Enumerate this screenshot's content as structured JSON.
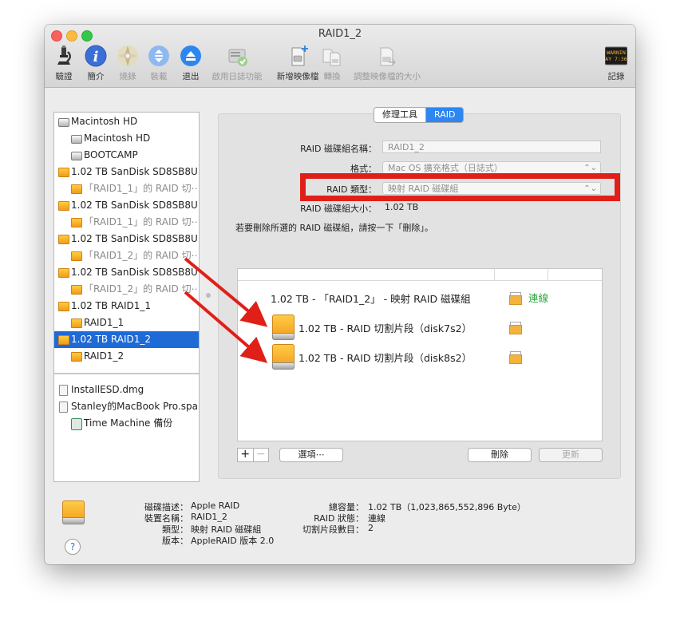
{
  "window": {
    "title": "RAID1_2"
  },
  "toolbar": {
    "items": [
      {
        "label": "驗證",
        "icon": "microscope-icon",
        "enabled": true
      },
      {
        "label": "簡介",
        "icon": "info-icon",
        "enabled": true
      },
      {
        "label": "燒錄",
        "icon": "burn-disc-icon",
        "enabled": false
      },
      {
        "label": "裝載",
        "icon": "mount-icon",
        "enabled": false
      },
      {
        "label": "退出",
        "icon": "eject-icon",
        "enabled": true
      },
      {
        "label": "啟用日誌功能",
        "icon": "journal-disk-icon",
        "enabled": false
      },
      {
        "label": "新增映像檔",
        "icon": "new-image-icon",
        "enabled": true
      },
      {
        "label": "轉換",
        "icon": "convert-icon",
        "enabled": false
      },
      {
        "label": "調整映像檔的大小",
        "icon": "resize-image-icon",
        "enabled": false
      }
    ],
    "log": {
      "label": "記錄",
      "icon": "log-icon",
      "screen_line1": "WARNIN",
      "screen_line2": "AY 7:36"
    }
  },
  "sidebar": {
    "items": [
      {
        "label": "Macintosh HD",
        "icon": "hard-disk-icon"
      },
      {
        "label": "Macintosh HD",
        "icon": "hard-disk-icon"
      },
      {
        "label": "BOOTCAMP",
        "icon": "hard-disk-icon"
      },
      {
        "label": "1.02 TB SanDisk SD8SB8U...",
        "icon": "orange-disk-icon"
      },
      {
        "label": "「RAID1_1」的 RAID 切⋯",
        "icon": "orange-disk-icon"
      },
      {
        "label": "1.02 TB SanDisk SD8SB8U...",
        "icon": "orange-disk-icon"
      },
      {
        "label": "「RAID1_1」的 RAID 切⋯",
        "icon": "orange-disk-icon"
      },
      {
        "label": "1.02 TB SanDisk SD8SB8U...",
        "icon": "orange-disk-icon"
      },
      {
        "label": "「RAID1_2」的 RAID 切⋯",
        "icon": "orange-disk-icon"
      },
      {
        "label": "1.02 TB SanDisk SD8SB8U...",
        "icon": "orange-disk-icon"
      },
      {
        "label": "「RAID1_2」的 RAID 切⋯",
        "icon": "orange-disk-icon"
      },
      {
        "label": "1.02 TB RAID1_1",
        "icon": "orange-disk-icon"
      },
      {
        "label": "RAID1_1",
        "icon": "orange-disk-icon"
      },
      {
        "label": "1.02 TB RAID1_2",
        "icon": "orange-disk-icon"
      },
      {
        "label": "RAID1_2",
        "icon": "orange-disk-icon"
      },
      {
        "label": "InstallESD.dmg",
        "icon": "dmg-icon"
      },
      {
        "label": "Stanley的MacBook Pro.spa...",
        "icon": "dmg-icon"
      },
      {
        "label": "Time Machine 備份",
        "icon": "time-machine-icon"
      }
    ]
  },
  "tabs": {
    "first_aid": "修理工具",
    "raid": "RAID"
  },
  "form": {
    "set_name_label": "RAID 磁碟組名稱：",
    "set_name_value": "RAID1_2",
    "format_label": "格式：",
    "format_value": "Mac OS 擴充格式（日誌式）",
    "type_label": "RAID 類型：",
    "type_value": "映射 RAID 磁碟組",
    "size_label": "RAID 磁碟組大小：",
    "size_value": "1.02 TB",
    "info": "若要刪除所選的 RAID 磁碟組，請按一下「刪除」。"
  },
  "raid_list": {
    "set_row": {
      "label": "1.02 TB - 「RAID1_2」 - 映射 RAID 磁碟組",
      "status": "連線"
    },
    "members": [
      {
        "label": "1.02 TB - RAID 切割片段（disk7s2）"
      },
      {
        "label": "1.02 TB - RAID 切割片段（disk8s2）"
      }
    ]
  },
  "buttons": {
    "plus": "+",
    "minus": "−",
    "options": "選項⋯",
    "delete": "刪除",
    "update": "更新"
  },
  "bottom_info": {
    "left": [
      {
        "label": "磁碟描述：",
        "value": "Apple RAID"
      },
      {
        "label": "裝置名稱：",
        "value": "RAID1_2"
      },
      {
        "label": "類型：",
        "value": "映射 RAID 磁碟組"
      },
      {
        "label": "版本：",
        "value": "AppleRAID 版本 2.0"
      }
    ],
    "right": [
      {
        "label": "總容量：",
        "value": "1.02 TB（1,023,865,552,896 Byte）"
      },
      {
        "label": "RAID 狀態：",
        "value": "連線"
      },
      {
        "label": "切割片段數目：",
        "value": "2"
      }
    ]
  },
  "help": "?",
  "colors": {
    "accent": "#1e6ad6",
    "annotation_red": "#e02018",
    "online_green": "#2ca83e",
    "disk_orange": "#f4b43c"
  }
}
